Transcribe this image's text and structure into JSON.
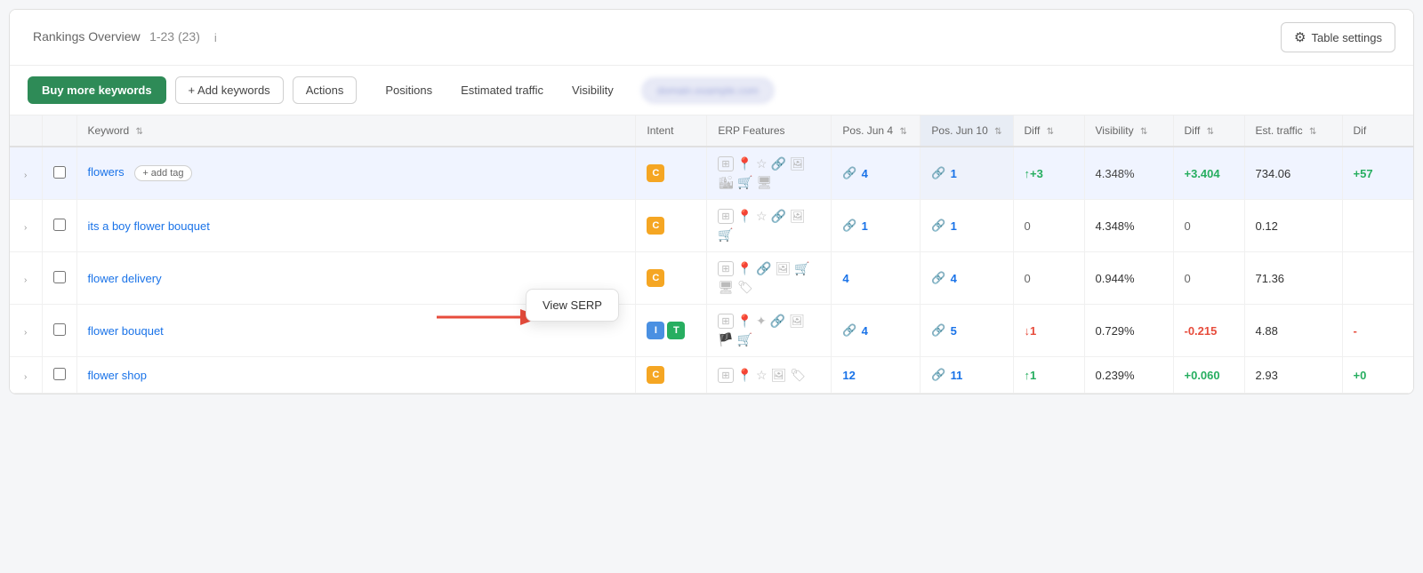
{
  "header": {
    "title": "Rankings Overview",
    "range": "1-23 (23)",
    "info_icon": "i",
    "table_settings_label": "Table settings"
  },
  "toolbar": {
    "buy_keywords_label": "Buy more keywords",
    "add_keywords_label": "+ Add keywords",
    "actions_label": "Actions",
    "tabs": [
      {
        "id": "positions",
        "label": "Positions",
        "active": false
      },
      {
        "id": "estimated-traffic",
        "label": "Estimated traffic",
        "active": false
      },
      {
        "id": "visibility",
        "label": "Visibility",
        "active": false
      }
    ],
    "domain_pill": "domain.example.com"
  },
  "table": {
    "columns": [
      {
        "id": "expand",
        "label": ""
      },
      {
        "id": "checkbox",
        "label": ""
      },
      {
        "id": "keyword",
        "label": "Keyword"
      },
      {
        "id": "intent",
        "label": "Intent"
      },
      {
        "id": "serp",
        "label": "ERP Features"
      },
      {
        "id": "pos_jun4",
        "label": "Pos. Jun 4"
      },
      {
        "id": "pos_jun10",
        "label": "Pos. Jun 10"
      },
      {
        "id": "diff",
        "label": "Diff"
      },
      {
        "id": "visibility",
        "label": "Visibility"
      },
      {
        "id": "vis_diff",
        "label": "Diff"
      },
      {
        "id": "est_traffic",
        "label": "Est. traffic"
      },
      {
        "id": "traffic_diff",
        "label": "Dif"
      }
    ],
    "rows": [
      {
        "id": 1,
        "keyword": "flowers",
        "add_tag": "+ add tag",
        "intent": [
          {
            "label": "C",
            "type": "c"
          }
        ],
        "pos_jun4": "4",
        "pos_jun10": "1",
        "diff": "+3",
        "diff_dir": "up",
        "visibility": "4.348%",
        "vis_diff": "+3.404",
        "vis_diff_dir": "up",
        "est_traffic": "734.06",
        "traffic_diff": "+57",
        "traffic_diff_dir": "up",
        "highlighted": true
      },
      {
        "id": 2,
        "keyword": "its a boy flower bouquet",
        "intent": [
          {
            "label": "C",
            "type": "c"
          }
        ],
        "pos_jun4": "1",
        "pos_jun10": "1",
        "diff": "0",
        "diff_dir": "neutral",
        "visibility": "4.348%",
        "vis_diff": "0",
        "vis_diff_dir": "neutral",
        "est_traffic": "0.12",
        "traffic_diff": "",
        "traffic_diff_dir": "neutral",
        "highlighted": false
      },
      {
        "id": 3,
        "keyword": "flower delivery",
        "intent": [
          {
            "label": "C",
            "type": "c"
          }
        ],
        "pos_jun4": "4",
        "pos_jun10": "4",
        "diff": "0",
        "diff_dir": "neutral",
        "visibility": "0.944%",
        "vis_diff": "0",
        "vis_diff_dir": "neutral",
        "est_traffic": "71.36",
        "traffic_diff": "",
        "traffic_diff_dir": "neutral",
        "highlighted": false
      },
      {
        "id": 4,
        "keyword": "flower bouquet",
        "intent": [
          {
            "label": "I",
            "type": "i"
          },
          {
            "label": "T",
            "type": "t"
          }
        ],
        "pos_jun4": "4",
        "pos_jun10": "5",
        "diff": "1",
        "diff_dir": "down",
        "visibility": "0.729%",
        "vis_diff": "-0.215",
        "vis_diff_dir": "down",
        "est_traffic": "4.88",
        "traffic_diff": "-",
        "traffic_diff_dir": "down",
        "highlighted": false
      },
      {
        "id": 5,
        "keyword": "flower shop",
        "intent": [
          {
            "label": "C",
            "type": "c"
          }
        ],
        "pos_jun4": "12",
        "pos_jun10": "11",
        "diff": "1",
        "diff_dir": "up",
        "visibility": "0.239%",
        "vis_diff": "+0.060",
        "vis_diff_dir": "up",
        "est_traffic": "2.93",
        "traffic_diff": "+0",
        "traffic_diff_dir": "up",
        "highlighted": false
      }
    ]
  },
  "tooltip": {
    "label": "View SERP"
  },
  "icons": {
    "gear": "⚙",
    "expand": "›",
    "location": "📍",
    "star": "☆",
    "link": "🔗",
    "image": "🖼",
    "cart": "🛒",
    "monitor": "🖥",
    "tag": "🏷",
    "link2": "↔",
    "serp_preview": "⊞"
  }
}
